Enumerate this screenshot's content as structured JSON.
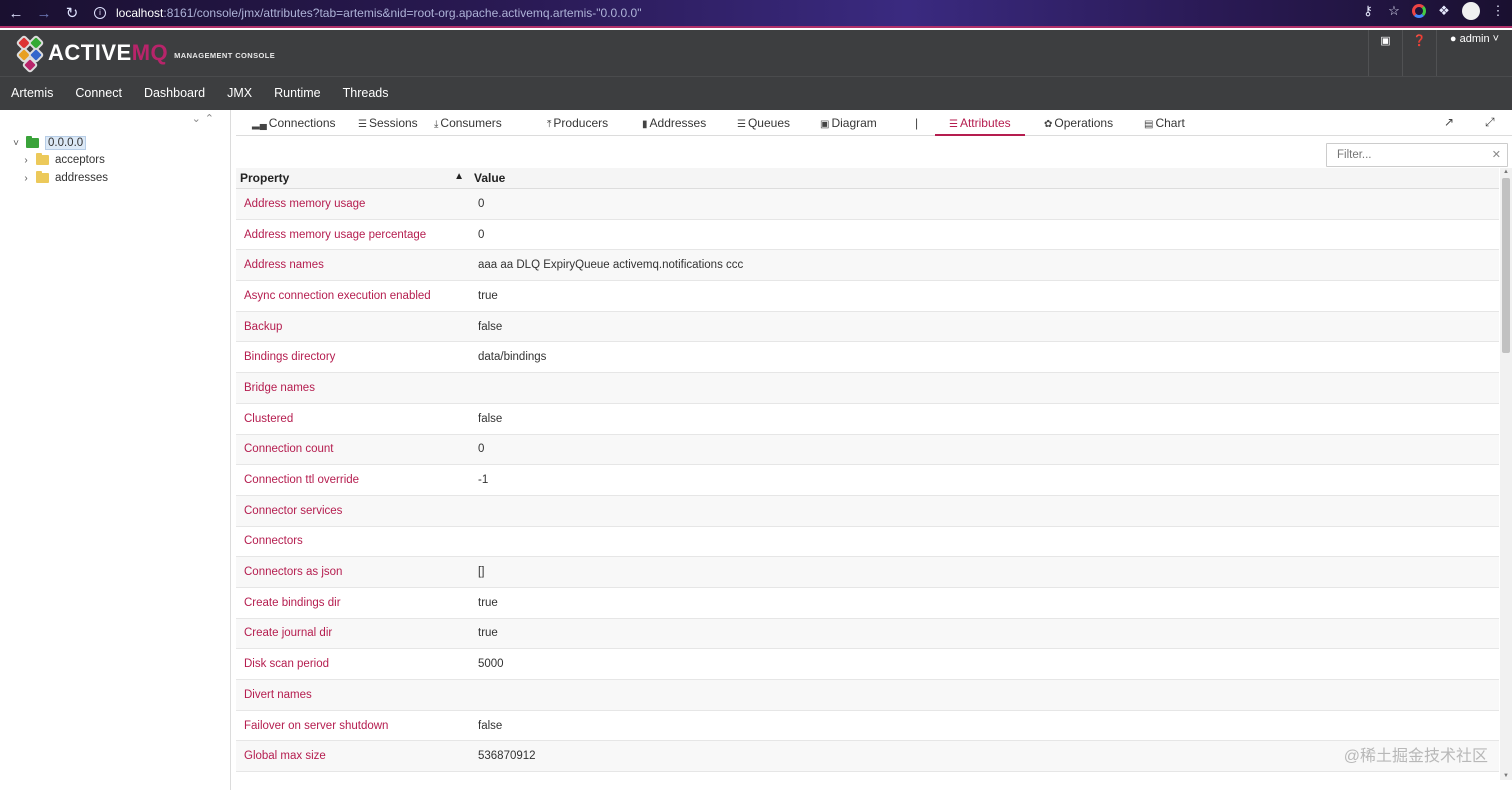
{
  "browser": {
    "url_host": "localhost",
    "url_rest": ":8161/console/jmx/attributes?tab=artemis&nid=root-org.apache.activemq.artemis-\"0.0.0.0\""
  },
  "app": {
    "logo_word_1": "ACTIVE",
    "logo_word_2": "MQ",
    "logo_sub": "MANAGEMENT CONSOLE",
    "user_label": "admin",
    "icons": [
      "monitor-icon",
      "help-icon",
      "user-icon"
    ]
  },
  "nav": [
    "Artemis",
    "Connect",
    "Dashboard",
    "JMX",
    "Runtime",
    "Threads"
  ],
  "tree": {
    "root": "0.0.0.0",
    "children": [
      "acceptors",
      "addresses"
    ]
  },
  "tabs": [
    {
      "label": "Connections",
      "icon": "bar-chart-icon"
    },
    {
      "label": "Sessions",
      "icon": "list-icon"
    },
    {
      "label": "Consumers",
      "icon": "download-icon"
    },
    {
      "label": "Producers",
      "icon": "upload-icon"
    },
    {
      "label": "Addresses",
      "icon": "book-icon"
    },
    {
      "label": "Queues",
      "icon": "list-icon"
    },
    {
      "label": "Diagram",
      "icon": "image-icon"
    },
    {
      "label": "Attributes",
      "icon": "list-icon",
      "active": true
    },
    {
      "label": "Operations",
      "icon": "leaf-icon"
    },
    {
      "label": "Chart",
      "icon": "chart-icon"
    }
  ],
  "tab_separator": "|",
  "filter": {
    "placeholder": "Filter..."
  },
  "table": {
    "headers": {
      "property": "Property",
      "value": "Value"
    },
    "rows": [
      {
        "k": "Address memory usage",
        "v": "0"
      },
      {
        "k": "Address memory usage percentage",
        "v": "0"
      },
      {
        "k": "Address names",
        "v": "aaa aa DLQ ExpiryQueue activemq.notifications ccc"
      },
      {
        "k": "Async connection execution enabled",
        "v": "true"
      },
      {
        "k": "Backup",
        "v": "false"
      },
      {
        "k": "Bindings directory",
        "v": "data/bindings"
      },
      {
        "k": "Bridge names",
        "v": ""
      },
      {
        "k": "Clustered",
        "v": "false"
      },
      {
        "k": "Connection count",
        "v": "0"
      },
      {
        "k": "Connection ttl override",
        "v": "-1"
      },
      {
        "k": "Connector services",
        "v": ""
      },
      {
        "k": "Connectors",
        "v": ""
      },
      {
        "k": "Connectors as json",
        "v": "[]"
      },
      {
        "k": "Create bindings dir",
        "v": "true"
      },
      {
        "k": "Create journal dir",
        "v": "true"
      },
      {
        "k": "Disk scan period",
        "v": "5000"
      },
      {
        "k": "Divert names",
        "v": ""
      },
      {
        "k": "Failover on server shutdown",
        "v": "false"
      },
      {
        "k": "Global max size",
        "v": "536870912"
      }
    ]
  },
  "watermark": "@稀土掘金技术社区"
}
